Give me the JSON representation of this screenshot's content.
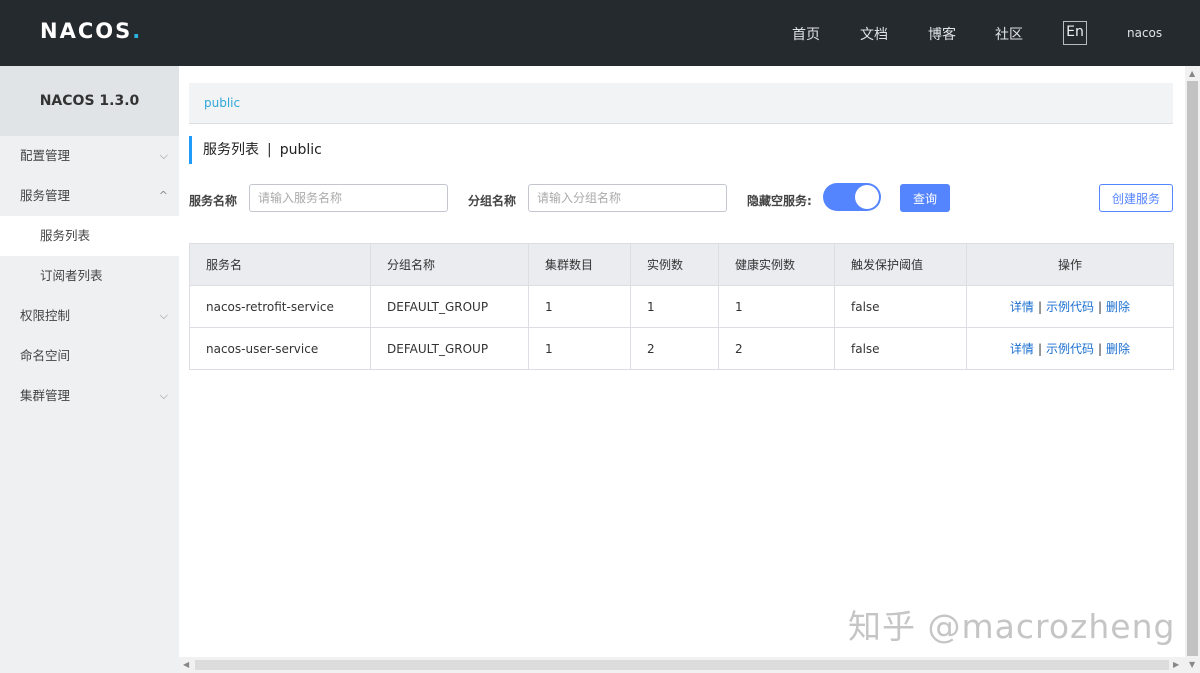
{
  "header": {
    "logo_text": "NACOS",
    "logo_dot": ".",
    "nav": [
      "首页",
      "文档",
      "博客",
      "社区"
    ],
    "lang_button": "En",
    "user": "nacos"
  },
  "sidebar": {
    "title": "NACOS 1.3.0",
    "items": [
      {
        "label": "配置管理",
        "chevron": "⌵"
      },
      {
        "label": "服务管理",
        "chevron": "^"
      },
      {
        "label": "服务列表"
      },
      {
        "label": "订阅者列表"
      },
      {
        "label": "权限控制",
        "chevron": "⌵"
      },
      {
        "label": "命名空间"
      },
      {
        "label": "集群管理",
        "chevron": "⌵"
      }
    ]
  },
  "breadcrumb": "public",
  "page_title": {
    "main": "服务列表",
    "sep": "|",
    "namespace": "public"
  },
  "filters": {
    "service_name_label": "服务名称",
    "service_name_placeholder": "请输入服务名称",
    "group_name_label": "分组名称",
    "group_name_placeholder": "请输入分组名称",
    "hide_empty_label": "隐藏空服务:",
    "hide_empty_on": true,
    "query_button": "查询",
    "create_button": "创建服务"
  },
  "table": {
    "headers": [
      "服务名",
      "分组名称",
      "集群数目",
      "实例数",
      "健康实例数",
      "触发保护阈值",
      "操作"
    ],
    "rows": [
      {
        "service": "nacos-retrofit-service",
        "group": "DEFAULT_GROUP",
        "clusters": "1",
        "instances": "1",
        "healthy": "1",
        "threshold": "false"
      },
      {
        "service": "nacos-user-service",
        "group": "DEFAULT_GROUP",
        "clusters": "1",
        "instances": "2",
        "healthy": "2",
        "threshold": "false"
      }
    ],
    "ops": {
      "detail": "详情",
      "sample": "示例代码",
      "delete": "删除",
      "sep": "|"
    }
  },
  "watermark": "知乎 @macrozheng",
  "colors": {
    "topbar": "#252a2f",
    "primary": "#5584ff",
    "link": "#1a6fd0",
    "accent": "#209bfa"
  }
}
